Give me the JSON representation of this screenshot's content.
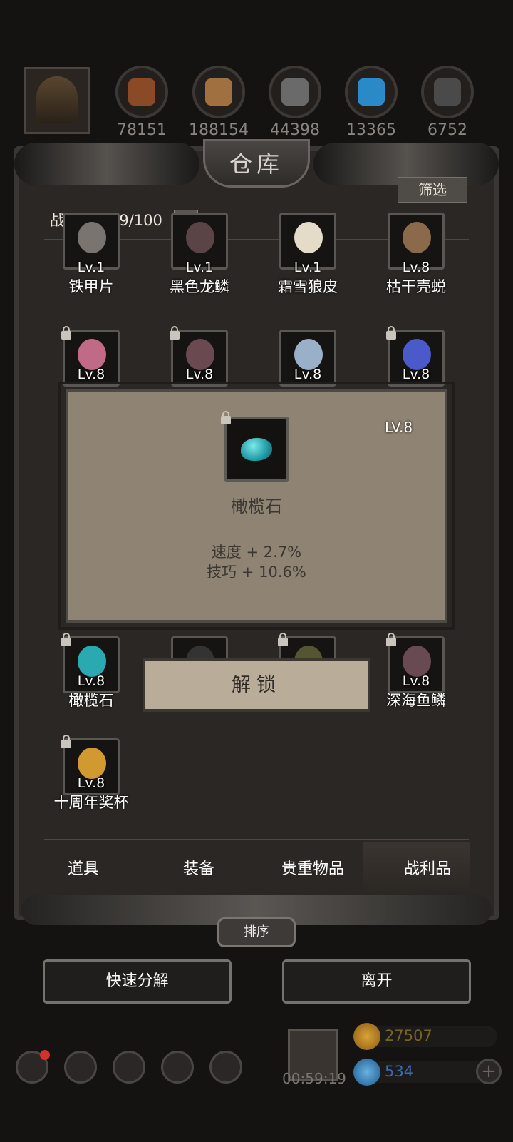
{
  "header": {
    "resources": [
      {
        "name": "wood-log-icon",
        "count": "78151",
        "color": "#8a4a26"
      },
      {
        "name": "plank-icon",
        "count": "188154",
        "color": "#a07040"
      },
      {
        "name": "iron-ingot-icon",
        "count": "44398",
        "color": "#6a6a6a"
      },
      {
        "name": "crystal-icon",
        "count": "13365",
        "color": "#2a8ac8"
      },
      {
        "name": "ore-icon",
        "count": "6752",
        "color": "#4a4a4a"
      }
    ]
  },
  "warehouse": {
    "title": "仓库",
    "filter_label": "筛选",
    "loot_label": "战利品：29/100",
    "add_label": "+"
  },
  "items": [
    {
      "lv": "Lv.1",
      "name": "铁甲片",
      "icon": "iron-plate-icon",
      "color": "#7a7470",
      "locked": false
    },
    {
      "lv": "Lv.1",
      "name": "黑色龙鳞",
      "icon": "dragon-scale-icon",
      "color": "#5a4446",
      "locked": false
    },
    {
      "lv": "Lv.1",
      "name": "霜雪狼皮",
      "icon": "wolf-pelt-icon",
      "color": "#e4dcc8",
      "locked": false
    },
    {
      "lv": "Lv.8",
      "name": "枯干壳蜕",
      "icon": "husk-icon",
      "color": "#8a6a4a",
      "locked": false
    },
    {
      "lv": "Lv.8",
      "name": "",
      "icon": "pink-shell-icon",
      "color": "#c06a88",
      "locked": true
    },
    {
      "lv": "Lv.8",
      "name": "",
      "icon": "scale-icon",
      "color": "#6a4a50",
      "locked": true
    },
    {
      "lv": "Lv.8",
      "name": "",
      "icon": "emblem-icon",
      "color": "#9ab0c8",
      "locked": false
    },
    {
      "lv": "Lv.8",
      "name": "",
      "icon": "necklace-icon",
      "color": "#4a5ac8",
      "locked": true
    },
    {
      "lv": "Lv.8",
      "name": "橄榄石",
      "icon": "olivine-icon",
      "color": "#2aaab0",
      "locked": true
    },
    {
      "lv": "",
      "name": "",
      "icon": "item-icon",
      "color": "#333",
      "locked": false
    },
    {
      "lv": "",
      "name": "",
      "icon": "item-icon",
      "color": "#553",
      "locked": true
    },
    {
      "lv": "Lv.8",
      "name": "深海鱼鳞",
      "icon": "fish-scale-icon",
      "color": "#6a4a52",
      "locked": true
    },
    {
      "lv": "Lv.8",
      "name": "十周年奖杯",
      "icon": "trophy-icon",
      "color": "#d09a30",
      "locked": true
    }
  ],
  "popup": {
    "lv": "LV.8",
    "name": "橄榄石",
    "stats": [
      "速度 + 2.7%",
      "技巧 + 10.6%"
    ],
    "unlock_label": "解锁"
  },
  "tabs": [
    {
      "label": "道具"
    },
    {
      "label": "装备"
    },
    {
      "label": "贵重物品"
    },
    {
      "label": "战利品",
      "active": true
    }
  ],
  "footer": {
    "sort_label": "排序",
    "quick_decompose_label": "快速分解",
    "leave_label": "离开",
    "timer": "00:59:19",
    "gold": "27507",
    "gems": "534"
  }
}
